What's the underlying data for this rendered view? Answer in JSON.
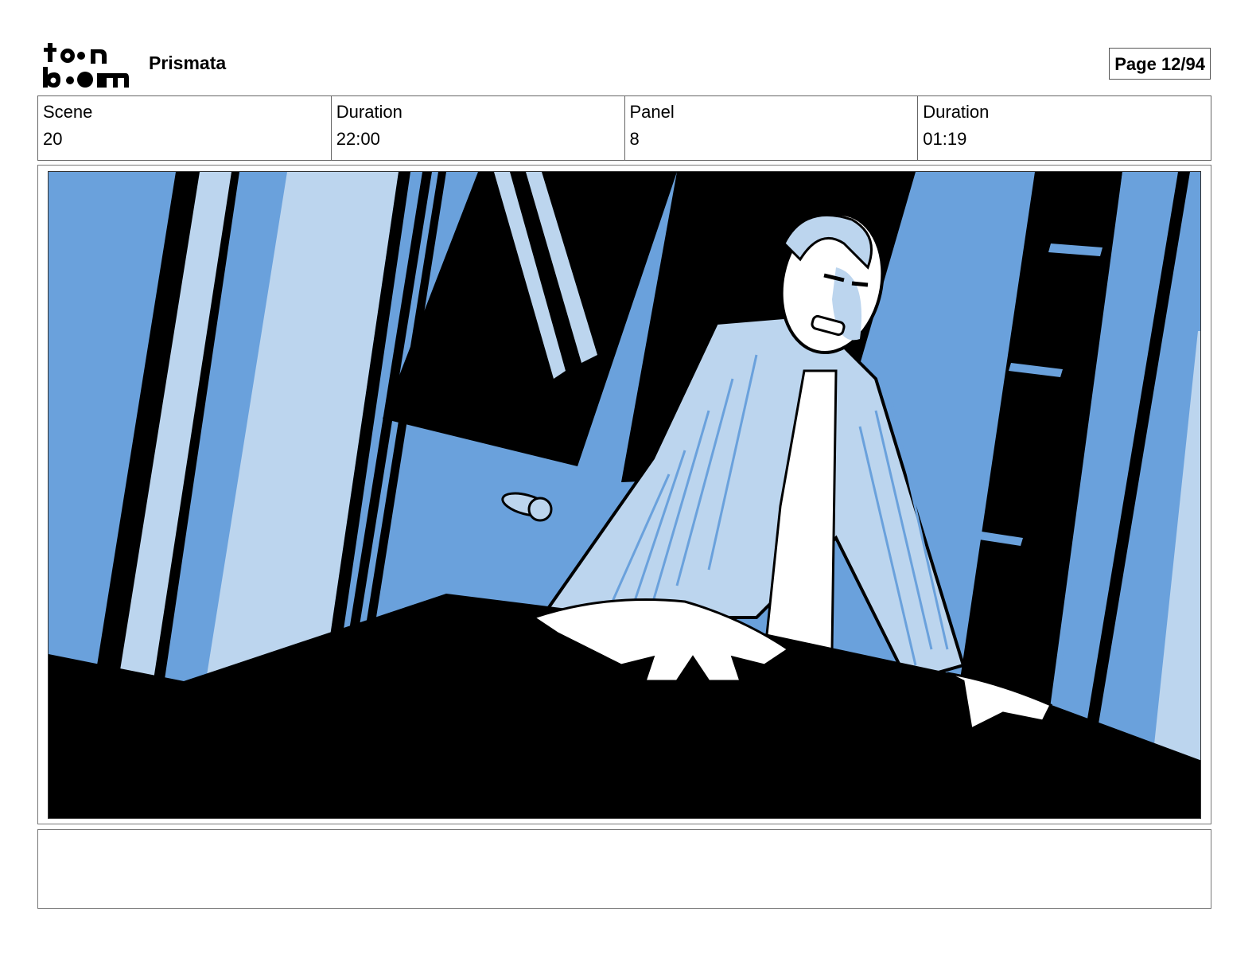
{
  "header": {
    "logo_lines": [
      "toon",
      "boom"
    ],
    "project_title": "Prismata",
    "page_label": "Page 12/94"
  },
  "info": {
    "scene_label": "Scene",
    "scene_value": "20",
    "scene_duration_label": "Duration",
    "scene_duration_value": "22:00",
    "panel_label": "Panel",
    "panel_value": "8",
    "panel_duration_label": "Duration",
    "panel_duration_value": "01:19"
  },
  "caption": {
    "text": ""
  },
  "colors": {
    "dark": "#000000",
    "mid_blue": "#6aa1dc",
    "light_blue": "#bcd5ee",
    "white": "#ffffff"
  }
}
